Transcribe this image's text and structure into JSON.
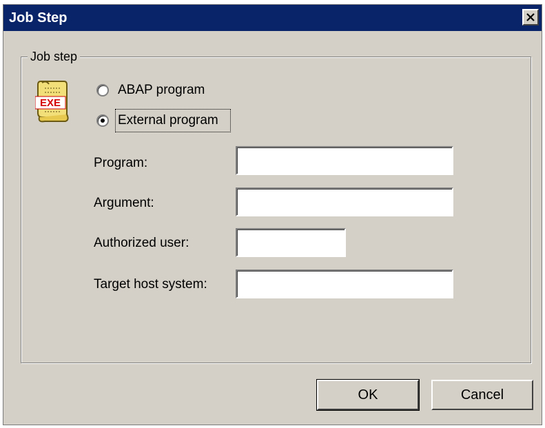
{
  "window": {
    "title": "Job Step"
  },
  "group": {
    "legend": "Job step"
  },
  "icon": {
    "name": "exe-program-icon",
    "text": "EXE"
  },
  "radios": {
    "abap_label": "ABAP program",
    "external_label": "External program",
    "selected": "external"
  },
  "fields": {
    "program_label": "Program:",
    "program_value": "",
    "argument_label": "Argument:",
    "argument_value": "",
    "user_label": "Authorized user:",
    "user_value": "",
    "host_label": "Target host system:",
    "host_value": ""
  },
  "buttons": {
    "ok_label": "OK",
    "cancel_label": "Cancel"
  }
}
